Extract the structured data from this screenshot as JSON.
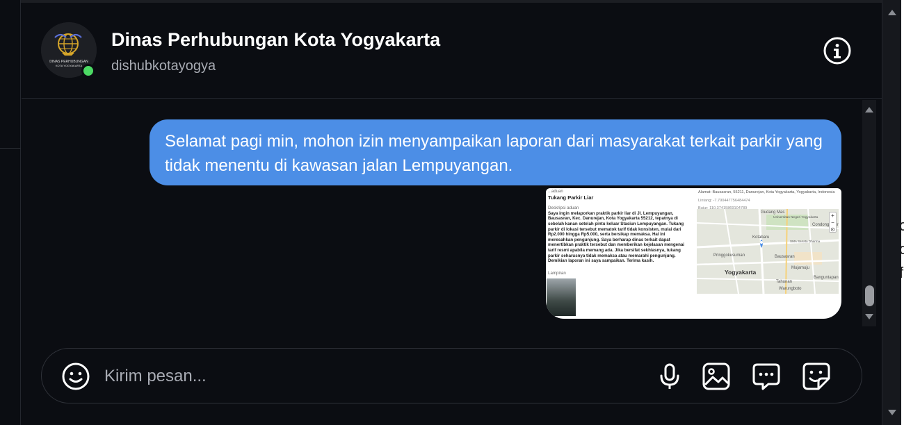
{
  "conversation": {
    "name": "Dinas Perhubungan Kota Yogyakarta",
    "username": "dishubkotayogya",
    "avatar_text": [
      "DINAS PERHUBUNGAN",
      "KOTA YOGYAKARTA"
    ],
    "online": true,
    "colors": {
      "online": "#4cd964",
      "bubble": "#4c8ee6",
      "background": "#0b0d12"
    }
  },
  "header": {
    "info_icon": "info-circle-icon"
  },
  "messages": [
    {
      "type": "text",
      "outgoing": true,
      "text": "Selamat pagi min, mohon izin menyampaikan laporan dari masyarakat terkait parkir yang tidak menentu di kawasan jalan Lempuyangan."
    },
    {
      "type": "image",
      "outgoing": true,
      "report": {
        "category_label": "...aduan",
        "category": "Tukang Parkir Liar",
        "description_label": "Deskripsi aduan",
        "description": "Saya ingin melaporkan praktik parkir liar di Jl. Lempuyangan, Bausasran, Kec. Danurejan, Kota Yogyakarta 55212, tepatnya di sebelah kanan setelah pintu keluar Stasiun Lempuyangan. Tukang parkir di lokasi tersebut mematok tarif tidak konsisten, mulai dari Rp2.000 hingga Rp5.000, serta bersikap memaksa. Hal ini meresahkan pengunjung. Saya berharap dinas terkait dapat menertibkan praktik tersebut dan memberikan kejelasan mengenai tarif resmi apabila memang ada. Jika bersifat sekhiasnya, tukang parkir seharusnya tidak memaksa atau memarahi pengunjung. Demikian laporan ini saya sampaikan. Terima kasih.",
        "attachment_label": "Lampiran",
        "address": "Alamat: Bausasran, 55211, Danurejan, Kota Yogyakarta, Yogyakarta, Indonesia",
        "latitude": "Lintang: -7.790447756484474",
        "longitude": "Bujur: 110.37415869104789",
        "map_labels": [
          "Gudang Mas",
          "Universitas Negeri Yogyakarta",
          "Condongcatur",
          "Kotabaru",
          "SMA Sanata Dharma",
          "Pringgokusuman",
          "Bausasran",
          "Yogyakarta",
          "Mujamuju",
          "Tahunan",
          "Banguntapan",
          "Warungboto"
        ],
        "map_city": "Yogyakarta"
      }
    }
  ],
  "composer": {
    "placeholder": "Kirim pesan...",
    "buttons": [
      "emoji-icon",
      "microphone-icon",
      "image-icon",
      "chat-bubble-icon",
      "sticker-icon"
    ]
  },
  "behind_window_glyphs": [
    "c",
    "c",
    "f"
  ]
}
